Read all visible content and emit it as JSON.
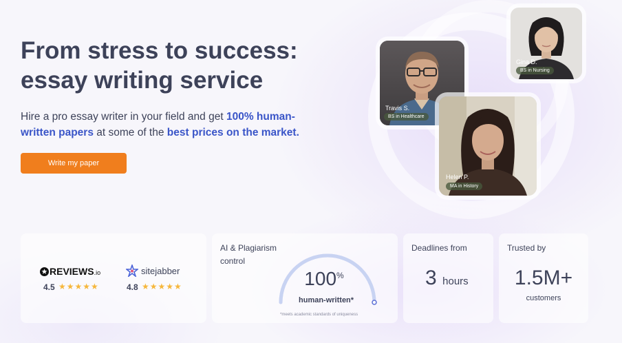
{
  "hero": {
    "title": "From stress to success: essay writing service",
    "subtitle_part1": "Hire a pro essay writer in your field and get ",
    "subtitle_hl1": "100% human-written papers",
    "subtitle_part2": " at some of the ",
    "subtitle_hl2": "best prices on the market.",
    "cta_label": "Write my paper"
  },
  "writers": [
    {
      "name": "Travis S.",
      "degree": "BS in Healthcare"
    },
    {
      "name": "Gina D.",
      "degree": "BS in Nursing"
    },
    {
      "name": "Helen P.",
      "degree": "MA in History"
    }
  ],
  "reviews": [
    {
      "brand": "REVIEWS",
      "brand_suffix": ".io",
      "rating": "4.5",
      "stars": 4.5
    },
    {
      "brand": "sitejabber",
      "rating": "4.8",
      "stars": 4.8
    }
  ],
  "ai_card": {
    "title": "AI & Plagiarism control",
    "value": "100",
    "unit": "%",
    "label": "human-written*",
    "footnote": "*meets academic standards of uniqueness",
    "progress": 1.0
  },
  "deadline_card": {
    "title": "Deadlines from",
    "value": "3",
    "unit": "hours"
  },
  "trust_card": {
    "title": "Trusted by",
    "value": "1.5M+",
    "label": "customers"
  },
  "colors": {
    "accent": "#f07e1d",
    "highlight": "#3a55c8",
    "text": "#3d4259",
    "star": "#f6b73c"
  }
}
